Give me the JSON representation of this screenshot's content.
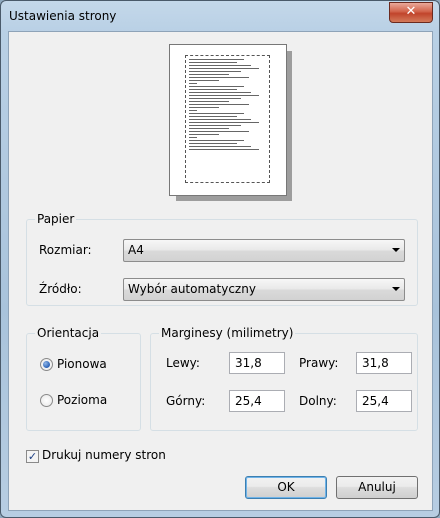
{
  "window": {
    "title": "Ustawienia strony",
    "close_glyph": "✕"
  },
  "paper": {
    "group_label": "Papier",
    "size_label": "Rozmiar:",
    "size_value": "A4",
    "source_label": "Źródło:",
    "source_value": "Wybór automatyczny"
  },
  "orientation": {
    "group_label": "Orientacja",
    "portrait_label": "Pionowa",
    "landscape_label": "Pozioma",
    "selected": "portrait"
  },
  "margins": {
    "group_label": "Marginesy (milimetry)",
    "left_label": "Lewy:",
    "left_value": "31,8",
    "right_label": "Prawy:",
    "right_value": "31,8",
    "top_label": "Górny:",
    "top_value": "25,4",
    "bottom_label": "Dolny:",
    "bottom_value": "25,4"
  },
  "print_page_numbers": {
    "label": "Drukuj numery stron",
    "checked": true,
    "check_glyph": "✓"
  },
  "buttons": {
    "ok": "OK",
    "cancel": "Anuluj"
  }
}
